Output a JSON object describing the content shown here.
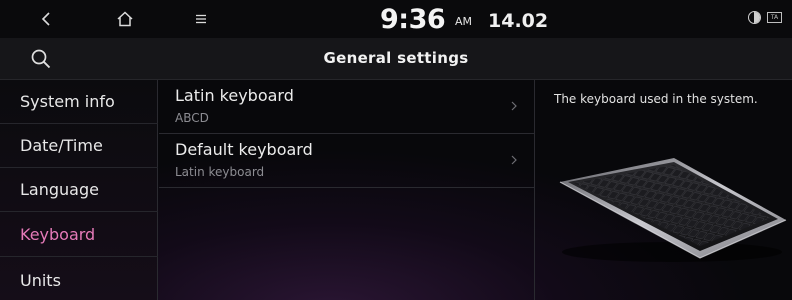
{
  "status_bar": {
    "time": "9:36",
    "ampm": "AM",
    "date": "14.02",
    "icons": [
      "back-icon",
      "home-icon",
      "menu-icon",
      "theme-icon",
      "ta-icon"
    ],
    "ta_label": "TA"
  },
  "header": {
    "title": "General settings",
    "search_icon": "search-icon"
  },
  "sidebar": {
    "items": [
      {
        "label": "System info",
        "active": false
      },
      {
        "label": "Date/Time",
        "active": false
      },
      {
        "label": "Language",
        "active": false
      },
      {
        "label": "Keyboard",
        "active": true
      },
      {
        "label": "Units",
        "active": false
      }
    ]
  },
  "settings_list": {
    "items": [
      {
        "title": "Latin keyboard",
        "value": "ABCD"
      },
      {
        "title": "Default keyboard",
        "value": "Latin keyboard"
      }
    ]
  },
  "info_panel": {
    "description": "The keyboard used in the system."
  },
  "colors": {
    "accent": "#e57ab8",
    "background": "#08080b",
    "header": "#161619"
  }
}
